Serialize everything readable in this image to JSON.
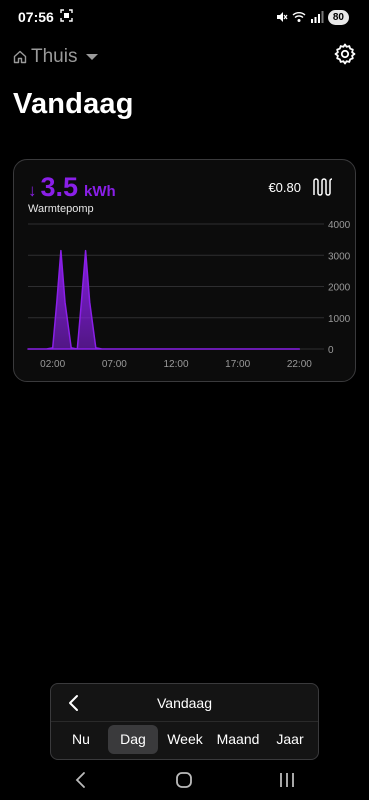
{
  "status_bar": {
    "time": "07:56",
    "battery": "80",
    "icons": [
      "screenshot-icon",
      "mute-icon",
      "wifi-icon",
      "signal-icon",
      "battery-icon"
    ]
  },
  "header": {
    "home_label": "Thuis",
    "icons": [
      "home-icon",
      "dropdown-caret-icon",
      "gear-icon"
    ]
  },
  "page": {
    "title": "Vandaag"
  },
  "card": {
    "value": "3.5",
    "unit": "kWh",
    "arrow": "↓",
    "device": "Warmtepomp",
    "cost": "€0.80",
    "accent_color": "#8a1fe8",
    "icons": [
      "down-arrow-icon",
      "tariff-icon"
    ]
  },
  "chart_data": {
    "type": "area",
    "title": "",
    "xlabel": "",
    "ylabel": "",
    "x_ticks": [
      "02:00",
      "07:00",
      "12:00",
      "17:00",
      "22:00"
    ],
    "y_ticks": [
      "4000",
      "3000",
      "2000",
      "1000",
      "0"
    ],
    "ylim": [
      0,
      4000
    ],
    "grid": true,
    "color": "#8a1fe8",
    "series": [
      {
        "x": [
          "00:00",
          "01:00",
          "01:30",
          "02:00",
          "02:20",
          "02:40",
          "03:00",
          "03:30",
          "04:00",
          "04:20",
          "04:40",
          "05:00",
          "05:30",
          "06:00",
          "07:00",
          "12:00",
          "17:00",
          "22:00"
        ],
        "values": [
          0,
          0,
          0,
          40,
          1500,
          3150,
          1500,
          40,
          0,
          1500,
          3150,
          1500,
          40,
          0,
          0,
          0,
          0,
          0
        ]
      }
    ]
  },
  "period": {
    "title": "Vandaag",
    "tabs": [
      "Nu",
      "Dag",
      "Week",
      "Maand",
      "Jaar"
    ],
    "active_tab": "Dag"
  },
  "nav": {
    "icons": [
      "back-icon",
      "home-icon",
      "recents-icon"
    ]
  }
}
